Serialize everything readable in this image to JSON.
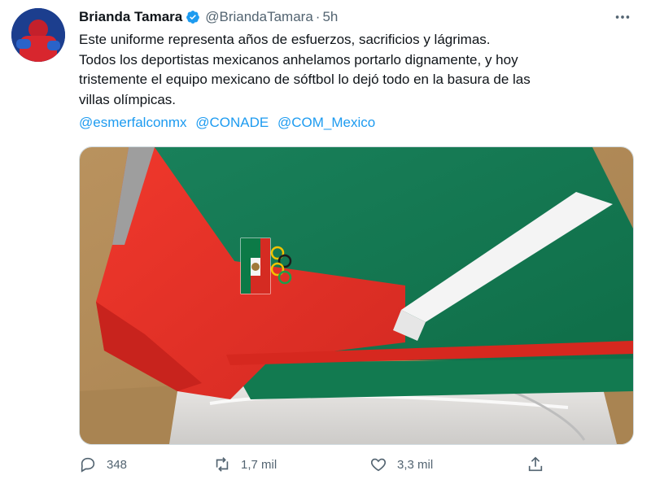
{
  "tweet": {
    "author_name": "Brianda Tamara",
    "handle": "@BriandaTamara",
    "separator": "·",
    "time": "5h",
    "text_lines": [
      "Este uniforme representa años de esfuerzos, sacrificios y lágrimas.",
      "Todos los deportistas mexicanos anhelamos portarlo dignamente, y hoy",
      "tristemente el equipo mexicano de sóftbol lo dejó todo en la basura de las",
      "villas olímpicas."
    ],
    "mentions": [
      "@esmerfalconmx",
      "@CONADE",
      "@COM_Mexico"
    ],
    "actions": {
      "replies": "348",
      "retweets": "1,7 mil",
      "likes": "3,3 mil"
    }
  },
  "icons": {
    "verified": "verified-badge-icon",
    "more": "more-icon",
    "reply": "reply-icon",
    "retweet": "retweet-icon",
    "like": "heart-icon",
    "share": "share-icon"
  },
  "colors": {
    "link": "#1d9bf0",
    "secondary_text": "#536471",
    "jacket_red": "#e8352a",
    "jacket_green": "#1e8a5a"
  }
}
